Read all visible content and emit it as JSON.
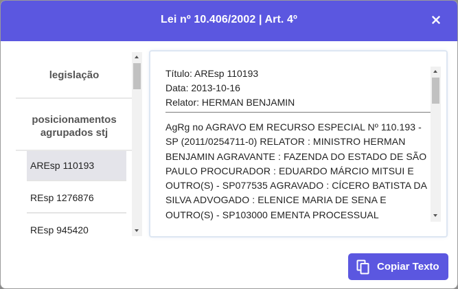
{
  "modal": {
    "title": "Lei nº 10.406/2002 | Art. 4º",
    "close_icon": "close-icon"
  },
  "nav": {
    "legislacao_label": "legislação",
    "posicionamentos_label_line1": "posicionamentos",
    "posicionamentos_label_line2": "agrupados stj",
    "cases": [
      {
        "label": "AREsp 110193",
        "active": true
      },
      {
        "label": "REsp 1276876",
        "active": false
      },
      {
        "label": "REsp 945420",
        "active": false
      }
    ]
  },
  "content": {
    "titulo": "Título: AREsp 110193",
    "data": "Data: 2013-10-16",
    "relator": "Relator: HERMAN BENJAMIN",
    "ementa": "AgRg no AGRAVO EM RECURSO ESPECIAL Nº 110.193 - SP (2011/0254711-0) RELATOR : MINISTRO HERMAN BENJAMIN AGRAVANTE : FAZENDA DO ESTADO DE SÃO PAULO PROCURADOR : EDUARDO MÁRCIO MITSUI E OUTRO(S) - SP077535 AGRAVADO : CÍCERO BATISTA DA SILVA ADVOGADO : ELENICE MARIA DE SENA E OUTRO(S) - SP103000 EMENTA PROCESSUAL"
  },
  "actions": {
    "copy_label": "Copiar Texto",
    "copy_icon": "copy-icon"
  },
  "colors": {
    "accent": "#5b57e0",
    "active_item_bg": "#e4e4ea"
  }
}
